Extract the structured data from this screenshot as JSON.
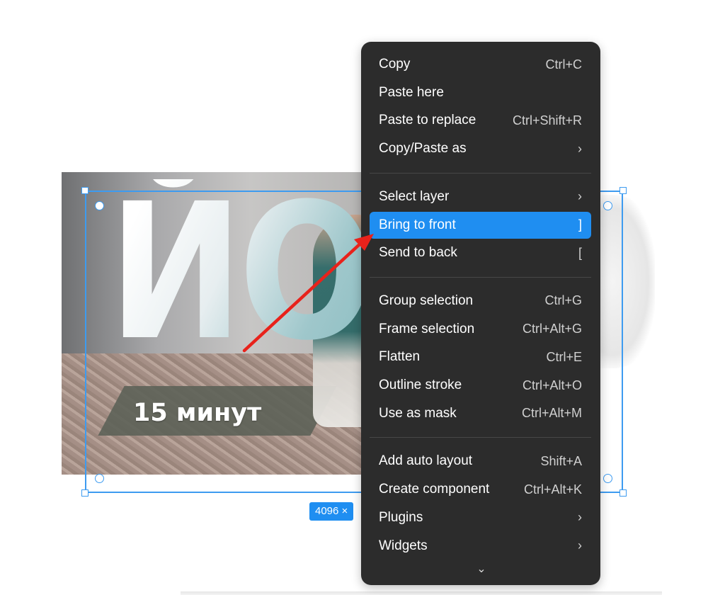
{
  "canvas": {
    "photo_title": "ЙОГ",
    "photo_subtitle": "15 минут",
    "size_label": "4096 ×"
  },
  "menu": {
    "groups": [
      [
        {
          "label": "Copy",
          "shortcut": "Ctrl+C"
        },
        {
          "label": "Paste here",
          "shortcut": ""
        },
        {
          "label": "Paste to replace",
          "shortcut": "Ctrl+Shift+R"
        },
        {
          "label": "Copy/Paste as",
          "shortcut": "›"
        }
      ],
      [
        {
          "label": "Select layer",
          "shortcut": "›"
        },
        {
          "label": "Bring to front",
          "shortcut": "]"
        },
        {
          "label": "Send to back",
          "shortcut": "["
        }
      ],
      [
        {
          "label": "Group selection",
          "shortcut": "Ctrl+G"
        },
        {
          "label": "Frame selection",
          "shortcut": "Ctrl+Alt+G"
        },
        {
          "label": "Flatten",
          "shortcut": "Ctrl+E"
        },
        {
          "label": "Outline stroke",
          "shortcut": "Ctrl+Alt+O"
        },
        {
          "label": "Use as mask",
          "shortcut": "Ctrl+Alt+M"
        }
      ],
      [
        {
          "label": "Add auto layout",
          "shortcut": "Shift+A"
        },
        {
          "label": "Create component",
          "shortcut": "Ctrl+Alt+K"
        },
        {
          "label": "Plugins",
          "shortcut": "›"
        },
        {
          "label": "Widgets",
          "shortcut": "›"
        }
      ]
    ],
    "more_icon": "chevron-down-icon",
    "more_glyph": "⌄"
  },
  "colors": {
    "accent": "#1f8ef1",
    "menu_bg": "#2c2c2c",
    "selection": "#3d9bf0",
    "annotation_arrow": "#e8221b"
  }
}
